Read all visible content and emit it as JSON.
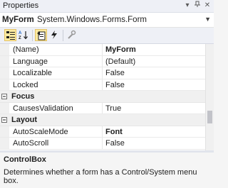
{
  "window": {
    "title": "Properties"
  },
  "object_selector": {
    "name": "MyForm",
    "type": "System.Windows.Forms.Form"
  },
  "toolbar": {
    "buttons": [
      {
        "icon": "categorized-icon",
        "active": true
      },
      {
        "icon": "alphabetical-icon",
        "active": false
      },
      {
        "icon": "properties-icon",
        "active": true
      },
      {
        "icon": "events-icon",
        "active": false
      },
      {
        "icon": "property-pages-icon",
        "active": false
      }
    ]
  },
  "grid": {
    "rows": [
      {
        "kind": "prop",
        "name": "(Name)",
        "value": "MyForm",
        "bold": true
      },
      {
        "kind": "prop",
        "name": "Language",
        "value": "(Default)",
        "bold": false
      },
      {
        "kind": "prop",
        "name": "Localizable",
        "value": "False",
        "bold": false
      },
      {
        "kind": "prop",
        "name": "Locked",
        "value": "False",
        "bold": false
      },
      {
        "kind": "cat",
        "name": "Focus"
      },
      {
        "kind": "prop",
        "name": "CausesValidation",
        "value": "True",
        "bold": false
      },
      {
        "kind": "cat",
        "name": "Layout"
      },
      {
        "kind": "prop",
        "name": "AutoScaleMode",
        "value": "Font",
        "bold": true
      },
      {
        "kind": "prop",
        "name": "AutoScroll",
        "value": "False",
        "bold": false
      }
    ]
  },
  "description": {
    "title": "ControlBox",
    "text": "Determines whether a form has a Control/System menu box."
  }
}
